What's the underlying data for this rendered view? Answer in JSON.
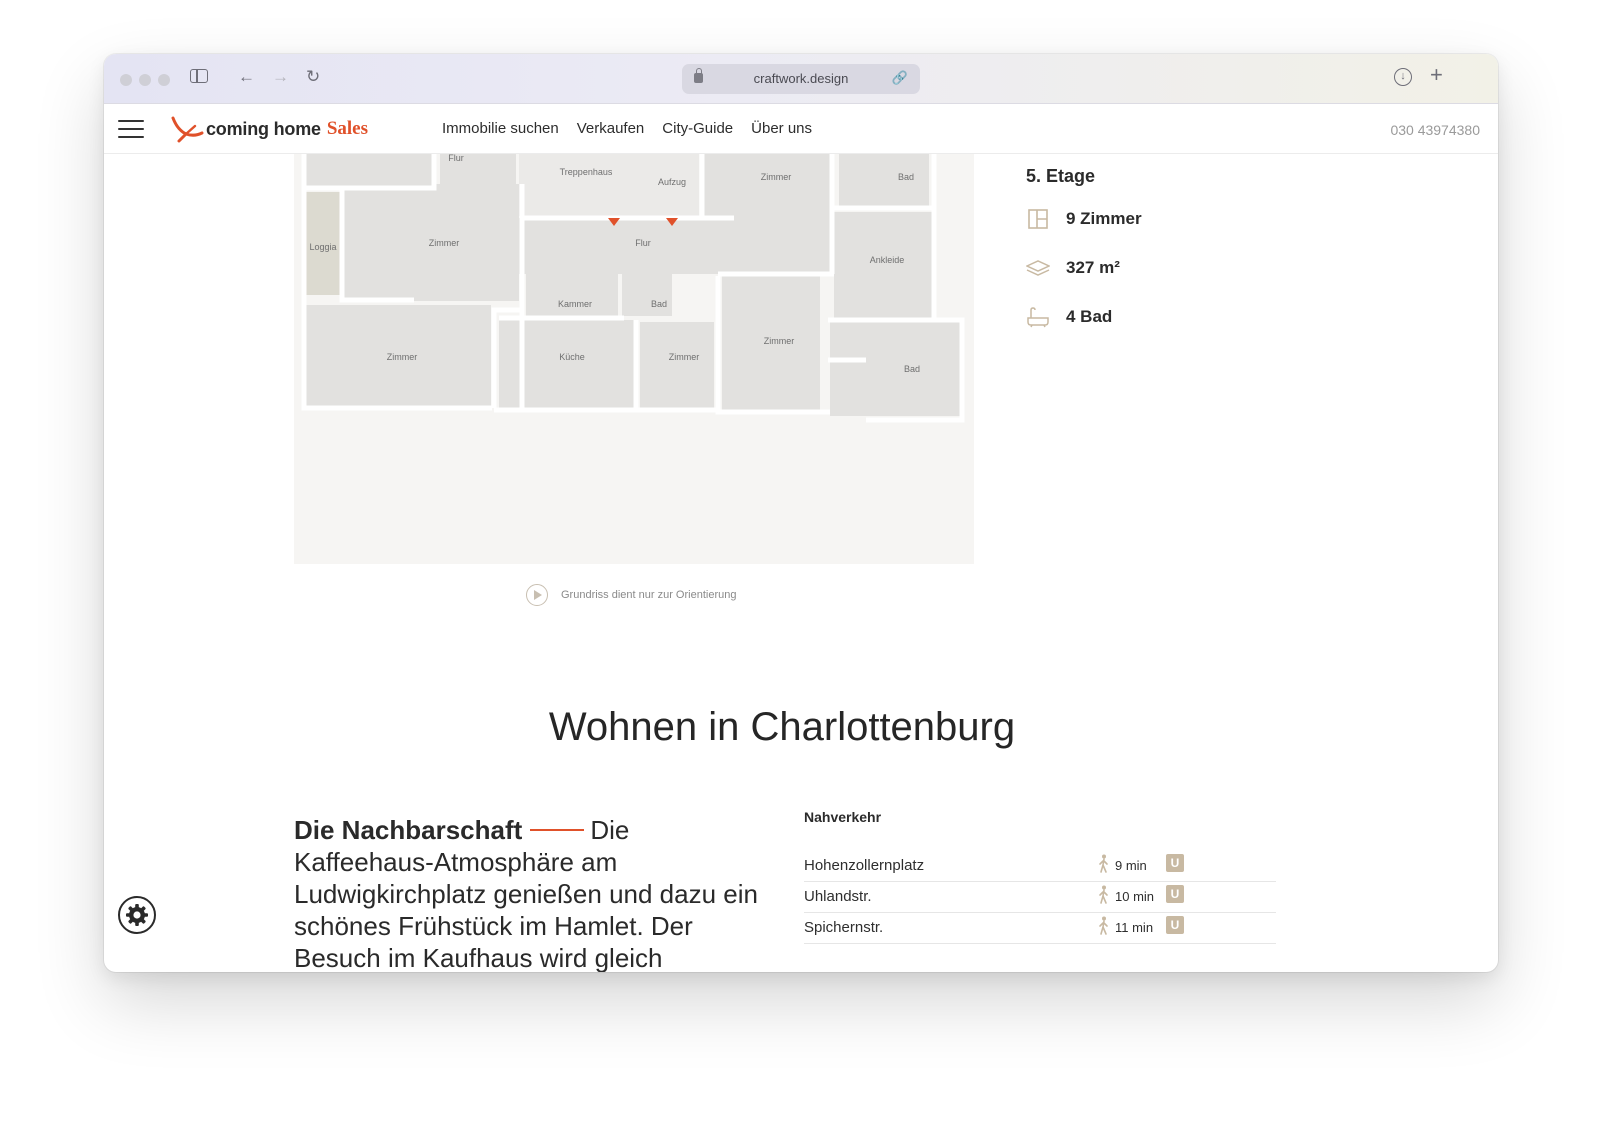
{
  "browser": {
    "url": "craftwork.design"
  },
  "header": {
    "brand": "coming home",
    "brand_accent": "Sales",
    "nav": [
      "Immobilie suchen",
      "Verkaufen",
      "City-Guide",
      "Über uns"
    ],
    "phone": "030 43974380"
  },
  "floorplan": {
    "rooms": [
      "Flur",
      "Treppenhaus",
      "Aufzug",
      "Zimmer",
      "Bad",
      "Loggia",
      "Zimmer",
      "Flur",
      "Ankleide",
      "Kammer",
      "Bad",
      "Zimmer",
      "Küche",
      "Zimmer",
      "Zimmer",
      "Bad"
    ],
    "caption": "Grundriss dient nur zur Orientierung"
  },
  "facts": {
    "floor": "5. Etage",
    "rooms": "9 Zimmer",
    "area": "327 m²",
    "baths": "4 Bad"
  },
  "section": {
    "title": "Wohnen in Charlottenburg"
  },
  "neighborhood": {
    "heading": "Die Nachbarschaft",
    "text": "Die Kaffeehaus-Atmosphäre am Ludwigkirchplatz genießen und dazu ein schönes Frühstück im Hamlet. Der Besuch im Kaufhaus wird gleich"
  },
  "transit": {
    "title": "Nahverkehr",
    "stations": [
      {
        "name": "Hohenzollernplatz",
        "time": "9 min",
        "line": "U"
      },
      {
        "name": "Uhlandstr.",
        "time": "10 min",
        "line": "U"
      },
      {
        "name": "Spichernstr.",
        "time": "11 min",
        "line": "U"
      }
    ]
  },
  "colors": {
    "accent": "#e0512a",
    "muted_tan": "#c8b9a2",
    "plan_room": "#e2e1df",
    "plan_loggia": "#dcdad0"
  }
}
